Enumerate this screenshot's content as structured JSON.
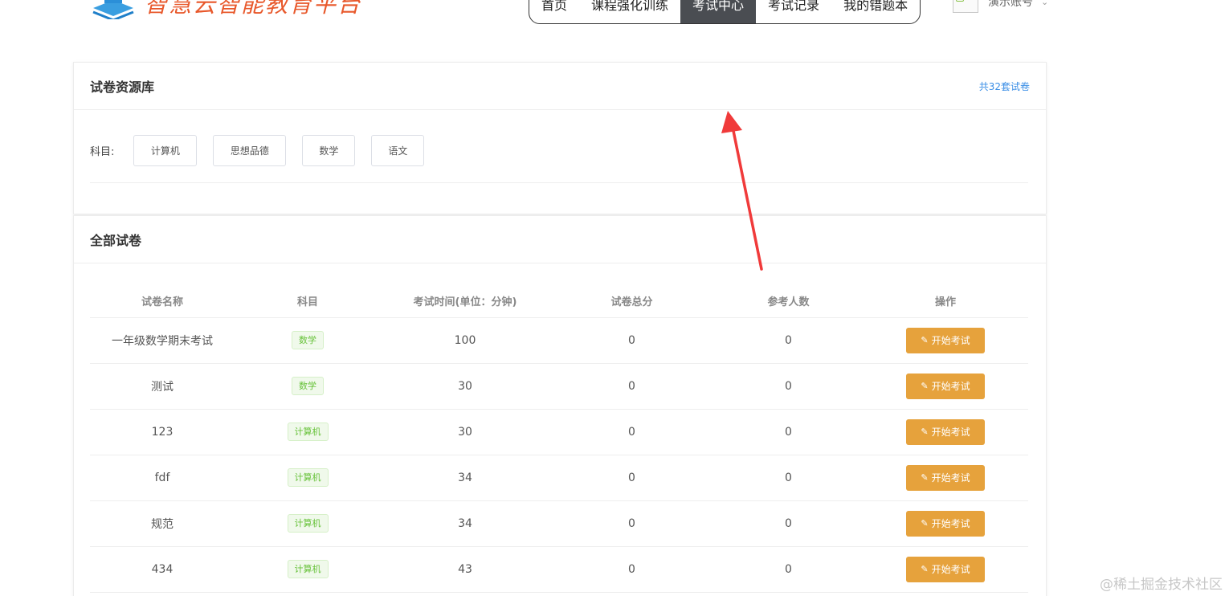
{
  "brand": {
    "name": "智慧云智能教育平台"
  },
  "nav": {
    "items": [
      {
        "label": "首页",
        "active": false
      },
      {
        "label": "课程强化训练",
        "active": false
      },
      {
        "label": "考试中心",
        "active": true
      },
      {
        "label": "考试记录",
        "active": false
      },
      {
        "label": "我的错题本",
        "active": false
      }
    ]
  },
  "account": {
    "name": "演示账号",
    "caret": "⌄"
  },
  "library": {
    "title": "试卷资源库",
    "count_link": "共32套试卷",
    "subject_label": "科目:",
    "subjects": [
      "计算机",
      "思想品德",
      "数学",
      "语文"
    ]
  },
  "exams": {
    "title": "全部试卷",
    "columns": [
      "试卷名称",
      "科目",
      "考试时间(单位：分钟)",
      "试卷总分",
      "参考人数",
      "操作"
    ],
    "action_label": "开始考试",
    "rows": [
      {
        "name": "一年级数学期末考试",
        "subject": "数学",
        "time": "100",
        "score": "0",
        "participants": "0"
      },
      {
        "name": "测试",
        "subject": "数学",
        "time": "30",
        "score": "0",
        "participants": "0"
      },
      {
        "name": "123",
        "subject": "计算机",
        "time": "30",
        "score": "0",
        "participants": "0"
      },
      {
        "name": "fdf",
        "subject": "计算机",
        "time": "34",
        "score": "0",
        "participants": "0"
      },
      {
        "name": "规范",
        "subject": "计算机",
        "time": "34",
        "score": "0",
        "participants": "0"
      },
      {
        "name": "434",
        "subject": "计算机",
        "time": "43",
        "score": "0",
        "participants": "0"
      }
    ]
  },
  "watermark": "@稀土掘金技术社区",
  "colors": {
    "accent": "#e6a23c",
    "nav_active": "#4a4d52",
    "tag_green": "#67c23a",
    "link_blue": "#3a8ee6",
    "arrow_red": "#f03a3a"
  }
}
